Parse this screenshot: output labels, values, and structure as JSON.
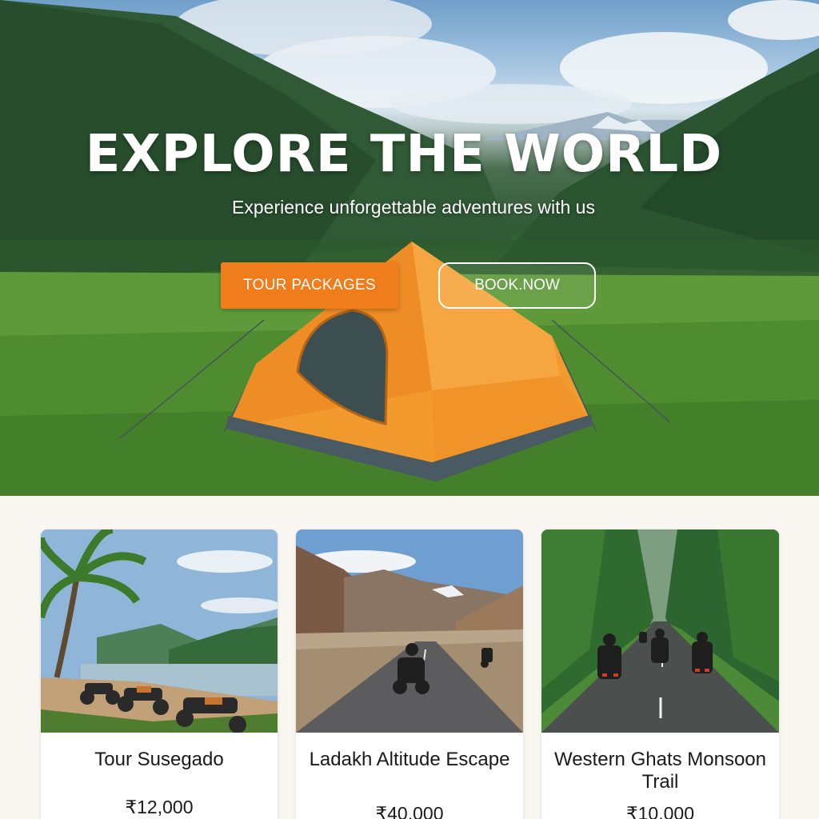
{
  "hero": {
    "nav_fragment": "",
    "title": "EXPLORE THE WORLD",
    "subtitle": "Experience unforgettable adventures with us",
    "tour_button": "TOUR PACKAGES",
    "book_button": "BOOK.NOW"
  },
  "tours": [
    {
      "title": "Tour Susegado",
      "price": "₹12,000"
    },
    {
      "title": "Ladakh Altitude Escape",
      "price": "₹40,000"
    },
    {
      "title": "Western Ghats Monsoon Trail",
      "price": "₹10,000"
    }
  ],
  "colors": {
    "accent": "#f07d1c",
    "tent_orange": "#f29a2e",
    "tent_base": "#4a5a63",
    "card_bg": "#ffffff",
    "section_bg": "#faf7f3"
  }
}
